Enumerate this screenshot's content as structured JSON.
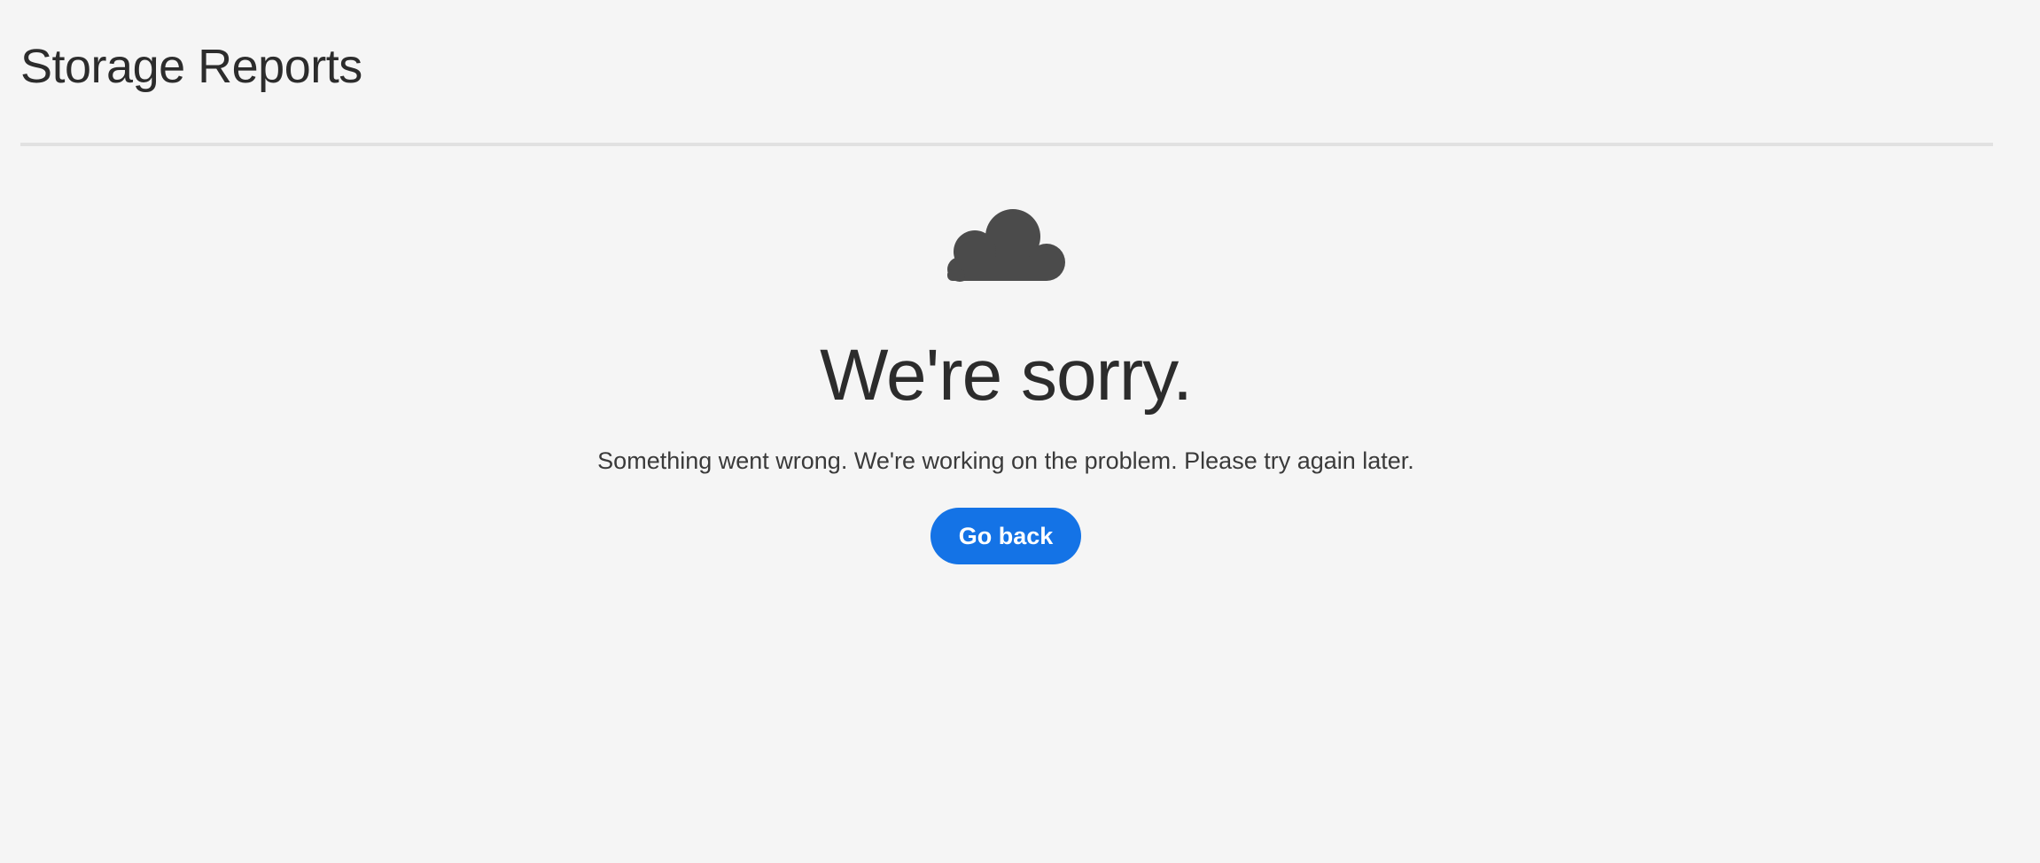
{
  "page": {
    "title": "Storage Reports"
  },
  "error": {
    "icon": "cloud-icon",
    "heading": "We're sorry.",
    "message": "Something went wrong. We're working on the problem. Please try again later.",
    "go_back_label": "Go back"
  },
  "colors": {
    "background": "#f5f5f5",
    "text": "#2c2c2c",
    "icon": "#4b4b4b",
    "button": "#1473e6",
    "divider": "#e1e1e1"
  }
}
